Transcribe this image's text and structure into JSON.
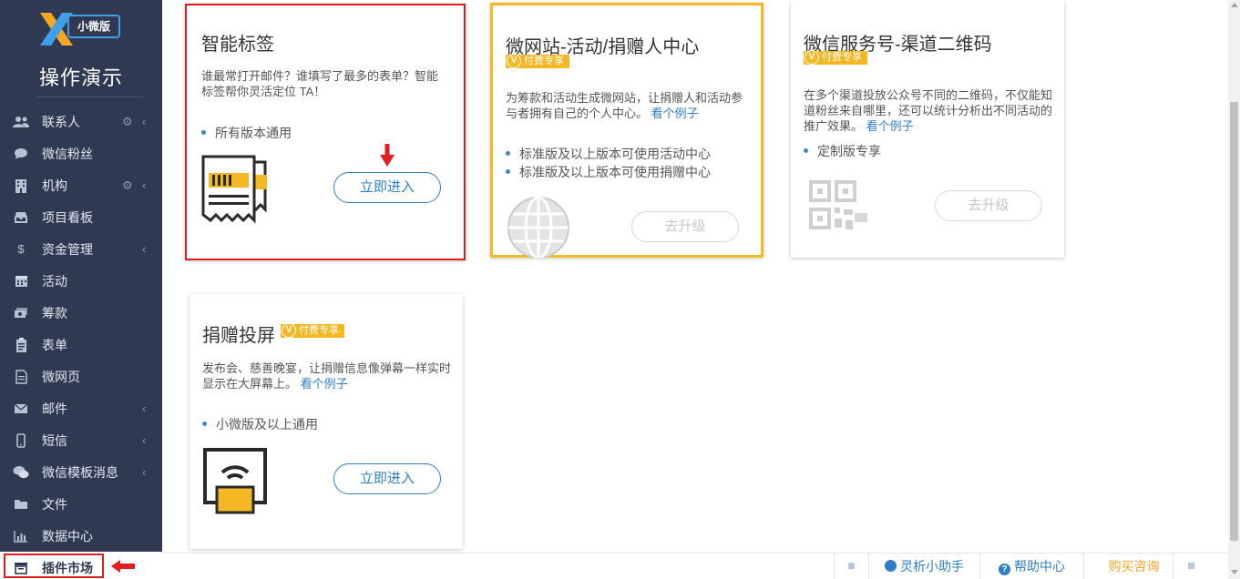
{
  "brand": {
    "logo_letter": "X",
    "logo_badge": "小微版",
    "site_title": "操作演示"
  },
  "sidebar": {
    "items": [
      {
        "label": "联系人",
        "icon": "contacts-icon",
        "gear": true,
        "chevron": true
      },
      {
        "label": "微信粉丝",
        "icon": "wechat-bubble-icon",
        "gear": false,
        "chevron": false
      },
      {
        "label": "机构",
        "icon": "building-icon",
        "gear": true,
        "chevron": true
      },
      {
        "label": "项目看板",
        "icon": "inbox-icon",
        "gear": false,
        "chevron": false
      },
      {
        "label": "资金管理",
        "icon": "dollar-icon",
        "gear": false,
        "chevron": true
      },
      {
        "label": "活动",
        "icon": "calendar-icon",
        "gear": false,
        "chevron": false
      },
      {
        "label": "筹款",
        "icon": "money-icon",
        "gear": false,
        "chevron": false
      },
      {
        "label": "表单",
        "icon": "clipboard-icon",
        "gear": false,
        "chevron": false
      },
      {
        "label": "微网页",
        "icon": "document-icon",
        "gear": false,
        "chevron": false
      },
      {
        "label": "邮件",
        "icon": "envelope-icon",
        "gear": false,
        "chevron": true
      },
      {
        "label": "短信",
        "icon": "mobile-icon",
        "gear": false,
        "chevron": true
      },
      {
        "label": "微信模板消息",
        "icon": "wechat-icon",
        "gear": false,
        "chevron": true
      },
      {
        "label": "文件",
        "icon": "folder-icon",
        "gear": false,
        "chevron": false
      },
      {
        "label": "数据中心",
        "icon": "bar-chart-icon",
        "gear": false,
        "chevron": false
      },
      {
        "label": "插件市场",
        "icon": "plugin-icon",
        "gear": false,
        "chevron": false,
        "active": true
      }
    ]
  },
  "cards": {
    "smart_tags": {
      "title": "智能标签",
      "desc": "谁最常打开邮件？谁填写了最多的表单？智能标签帮你灵活定位 TA！",
      "bullets": [
        "所有版本通用"
      ],
      "button": "立即进入"
    },
    "micro_site": {
      "title": "微网站-活动/捐赠人中心",
      "badge": "付费专享",
      "desc": "为筹款和活动生成微网站，让捐赠人和活动参与者拥有自己的个人中心。",
      "link": "看个例子",
      "bullets": [
        "标准版及以上版本可使用活动中心",
        "标准版及以上版本可使用捐赠中心"
      ],
      "button": "去升级"
    },
    "wechat_qr": {
      "title": "微信服务号-渠道二维码",
      "badge": "付费专享",
      "desc": "在多个渠道投放公众号不同的二维码，不仅能知道粉丝来自哪里，还可以统计分析出不同活动的推广效果。",
      "link": "看个例子",
      "bullets": [
        "定制版专享"
      ],
      "button": "去升级"
    },
    "donation_screen": {
      "title": "捐赠投屏",
      "badge": "付费专享",
      "desc": "发布会、慈善晚宴，让捐赠信息像弹幕一样实时显示在大屏幕上。",
      "link": "看个例子",
      "bullets": [
        "小微版及以上通用"
      ],
      "button": "立即进入"
    }
  },
  "footer": {
    "assistant": "灵析小助手",
    "help": "帮助中心",
    "buy": "购买咨询"
  },
  "colors": {
    "sidebar_bg": "#2f3a52",
    "accent_blue": "#2e7fc7",
    "paid_yellow": "#f5b825",
    "highlight_red": "#e01e1e"
  }
}
